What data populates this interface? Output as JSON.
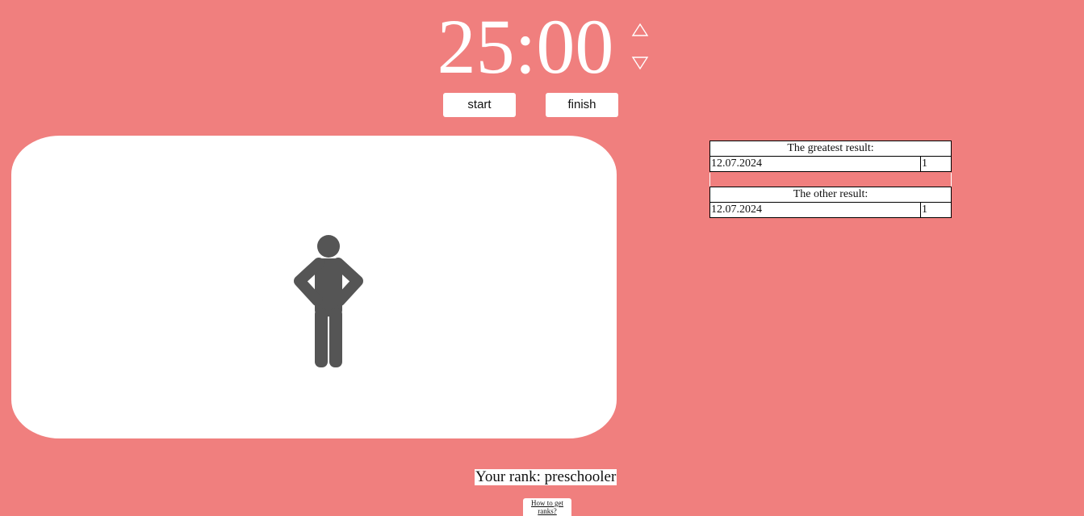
{
  "timer": {
    "display": "25:00",
    "increase_icon": "triangle-up-outline-icon",
    "decrease_icon": "triangle-down-outline-icon"
  },
  "controls": {
    "start_label": "start",
    "finish_label": "finish"
  },
  "stage": {
    "figure_icon": "standing-person-hands-on-hips-icon",
    "figure_color": "#555555"
  },
  "results": {
    "greatest": {
      "title": "The greatest result:",
      "rows": [
        {
          "date": "12.07.2024",
          "value": "1"
        }
      ]
    },
    "other": {
      "title": "The other result:",
      "rows": [
        {
          "date": "12.07.2024",
          "value": "1"
        }
      ]
    }
  },
  "rank": {
    "text": "Your rank: preschooler"
  },
  "help_link": {
    "text": "How to get ranks?"
  },
  "colors": {
    "background": "#f07f7e",
    "panel": "#ffffff",
    "figure": "#555555"
  }
}
